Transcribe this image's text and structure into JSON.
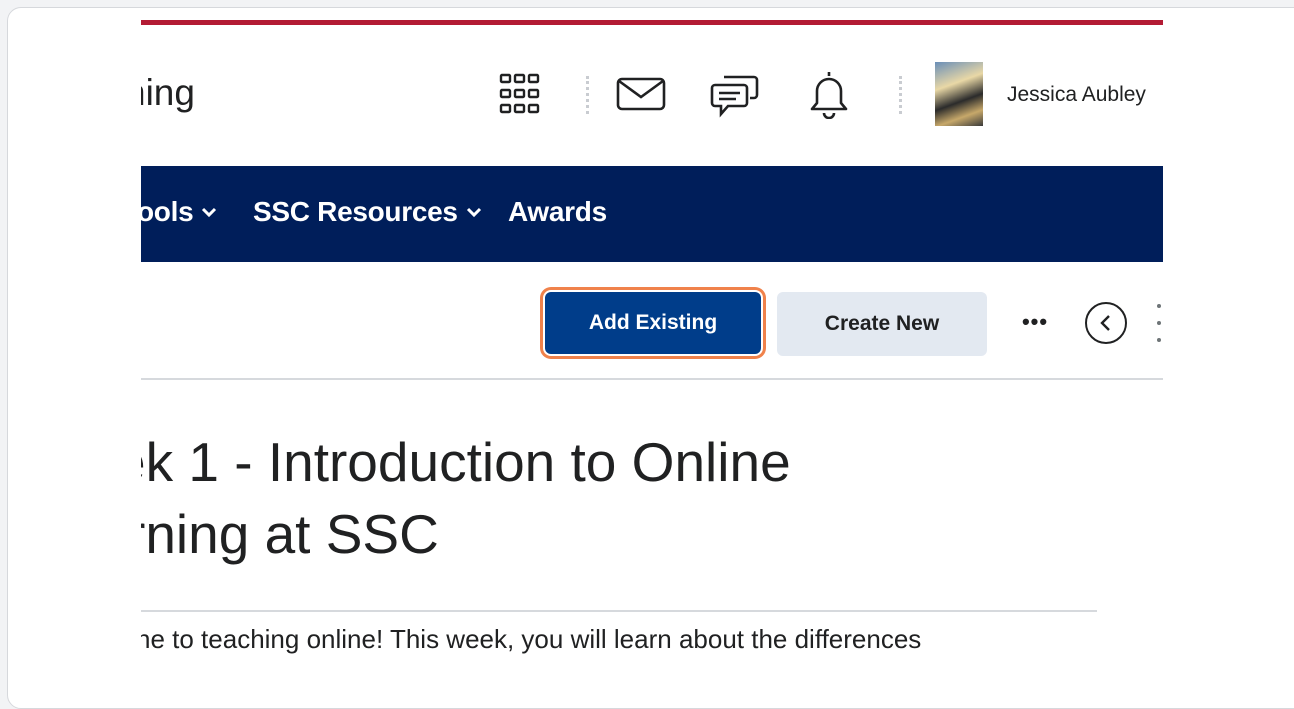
{
  "header": {
    "app_title": "ning",
    "user_name": "Jessica Aubley",
    "icons": [
      "grid-icon",
      "mail-icon",
      "chat-icon",
      "bell-icon"
    ]
  },
  "nav": {
    "items": [
      {
        "label": "ools",
        "has_dropdown": true
      },
      {
        "label": "SSC Resources",
        "has_dropdown": true
      },
      {
        "label": "Awards",
        "has_dropdown": false
      }
    ]
  },
  "toolbar": {
    "add_existing_label": "Add Existing",
    "create_new_label": "Create New",
    "more_label": "•••"
  },
  "content": {
    "heading_line1": "ek 1 - Introduction to Online",
    "heading_line2": "rning at SSC",
    "intro_text": "ne to teaching online! This week, you will learn about the differences"
  },
  "colors": {
    "top_accent": "#b31b34",
    "nav_background": "#001e5a",
    "primary_button": "#003d8a",
    "secondary_button": "#e3e9f1",
    "focus_ring": "#f0824b"
  }
}
